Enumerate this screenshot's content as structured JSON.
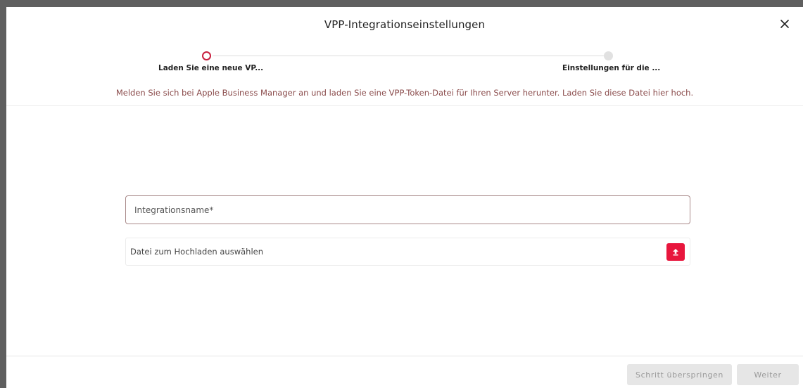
{
  "dialog": {
    "title": "VPP-Integrationseinstellungen",
    "close_icon": "close-icon"
  },
  "stepper": {
    "steps": [
      {
        "label": "Laden Sie eine neue VP...",
        "state": "active"
      },
      {
        "label": "Einstellungen für die ...",
        "state": "inactive"
      }
    ]
  },
  "instruction": "Melden Sie sich bei Apple Business Manager an und laden Sie eine VPP-Token-Datei für Ihren Server herunter. Laden Sie diese Datei hier hoch.",
  "form": {
    "integration_name_placeholder": "Integrationsname*",
    "file_upload_label": "Datei zum Hochladen auswählen",
    "upload_icon": "upload-icon"
  },
  "footer": {
    "skip_label": "Schritt überspringen",
    "next_label": "Weiter"
  },
  "colors": {
    "accent": "#e8163d",
    "instruction_text": "#8a4b4b",
    "disabled_button": "#e6e6e6"
  }
}
